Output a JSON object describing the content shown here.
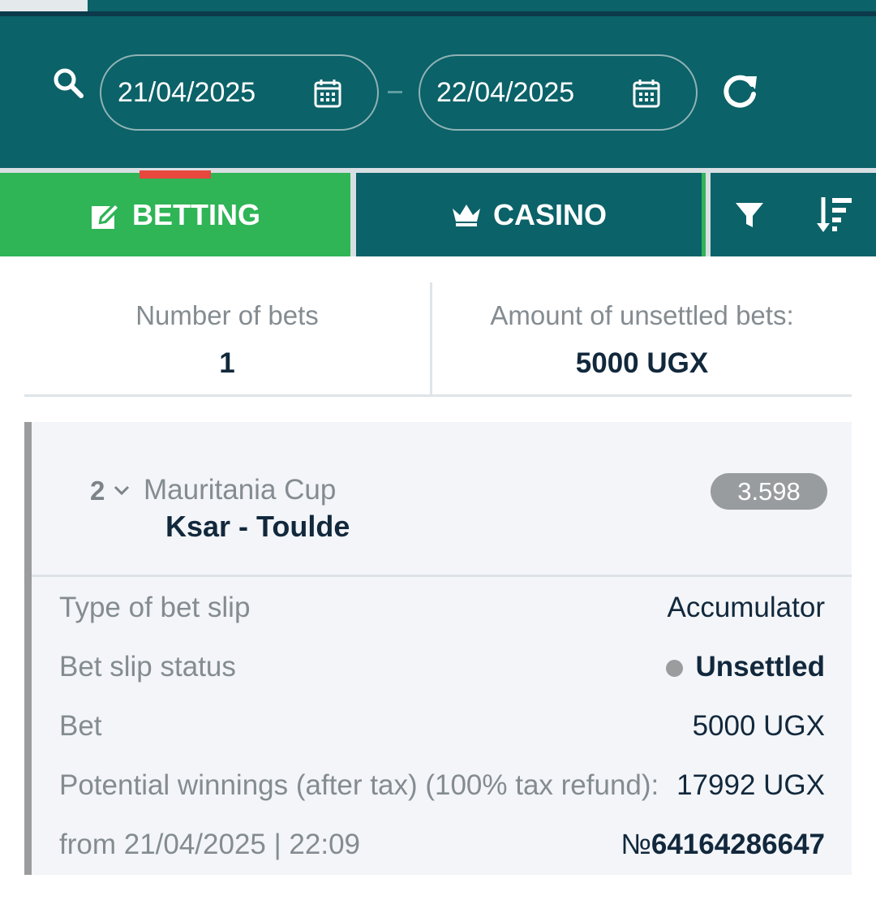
{
  "date_filter": {
    "from_date": "21/04/2025",
    "to_date": "22/04/2025",
    "separator": "–",
    "icons": [
      "search-icon",
      "calendar-icon",
      "refresh-icon"
    ]
  },
  "tabs": {
    "betting_label": "BETTING",
    "casino_label": "CASINO",
    "icons": [
      "edit-icon",
      "crown-icon",
      "filter-icon",
      "sort-icon"
    ],
    "active": "BETTING"
  },
  "summary": {
    "bets_label": "Number of bets",
    "bets_value": "1",
    "unsettled_label": "Amount of unsettled bets:",
    "unsettled_value": "5000 UGX"
  },
  "bet_slip": {
    "event_count": "2",
    "tournament": "Mauritania Cup",
    "match": "Ksar - Toulde",
    "odds": "3.598",
    "rows": [
      {
        "label": "Type of bet slip",
        "value": "Accumulator"
      },
      {
        "label": "Bet slip status",
        "value": "Unsettled"
      },
      {
        "label": "Bet",
        "value": "5000 UGX"
      },
      {
        "label": "Potential winnings (after tax) (100% tax refund):",
        "value": "17992 UGX"
      }
    ],
    "date_text": "from 21/04/2025 | 22:09",
    "number_prefix": "№",
    "number": "64164286647"
  },
  "colors": {
    "header_teal": "#0b6268",
    "betting_green": "#2fb456",
    "active_red": "#e8473e",
    "text_dark": "#12283c",
    "text_grey": "#848c91"
  }
}
